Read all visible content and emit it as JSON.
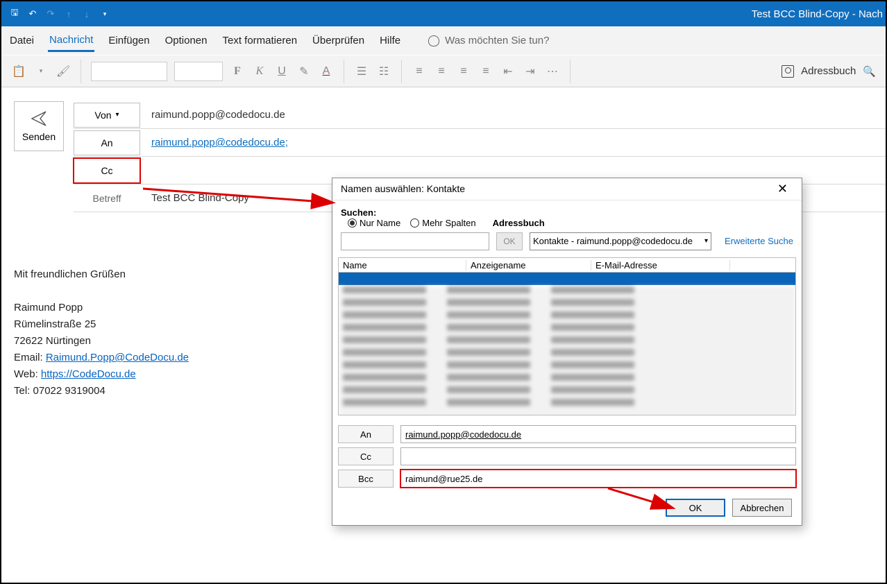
{
  "window": {
    "title": "Test BCC Blind-Copy  -  Nach"
  },
  "tabs": {
    "datei": "Datei",
    "nachricht": "Nachricht",
    "einfuegen": "Einfügen",
    "optionen": "Optionen",
    "text": "Text formatieren",
    "ueberpruefen": "Überprüfen",
    "hilfe": "Hilfe",
    "tellme": "Was möchten Sie tun?"
  },
  "ribbon": {
    "addressbook": "Adressbuch"
  },
  "compose": {
    "send": "Senden",
    "von_label": "Von",
    "an_label": "An",
    "cc_label": "Cc",
    "betreff_label": "Betreff",
    "von_value": "raimund.popp@codedocu.de",
    "an_value": "raimund.popp@codedocu.de;",
    "cc_value": "",
    "subject_value": "Test BCC Blind-Copy"
  },
  "body": {
    "greeting": "Mit freundlichen Grüßen",
    "name": "Raimund Popp",
    "street": "Rümelinstraße 25",
    "city": "72622 Nürtingen",
    "email_label": "Email: ",
    "email": "Raimund.Popp@CodeDocu.de",
    "web_label": "Web: ",
    "web": "https://CodeDocu.de",
    "tel": "Tel: 07022 9319004"
  },
  "dialog": {
    "title": "Namen auswählen: Kontakte",
    "suchen_label": "Suchen:",
    "radio_name": "Nur Name",
    "radio_mehr": "Mehr Spalten",
    "ok_small": "OK",
    "ab_label": "Adressbuch",
    "ab_select": "Kontakte - raimund.popp@codedocu.de",
    "erw": "Erweiterte Suche",
    "col_name": "Name",
    "col_anzeige": "Anzeigename",
    "col_email": "E-Mail-Adresse",
    "an_label": "An",
    "cc_label": "Cc",
    "bcc_label": "Bcc",
    "an_value": "raimund.popp@codedocu.de",
    "cc_value": "",
    "bcc_value": "raimund@rue25.de",
    "btn_ok": "OK",
    "btn_cancel": "Abbrechen"
  }
}
